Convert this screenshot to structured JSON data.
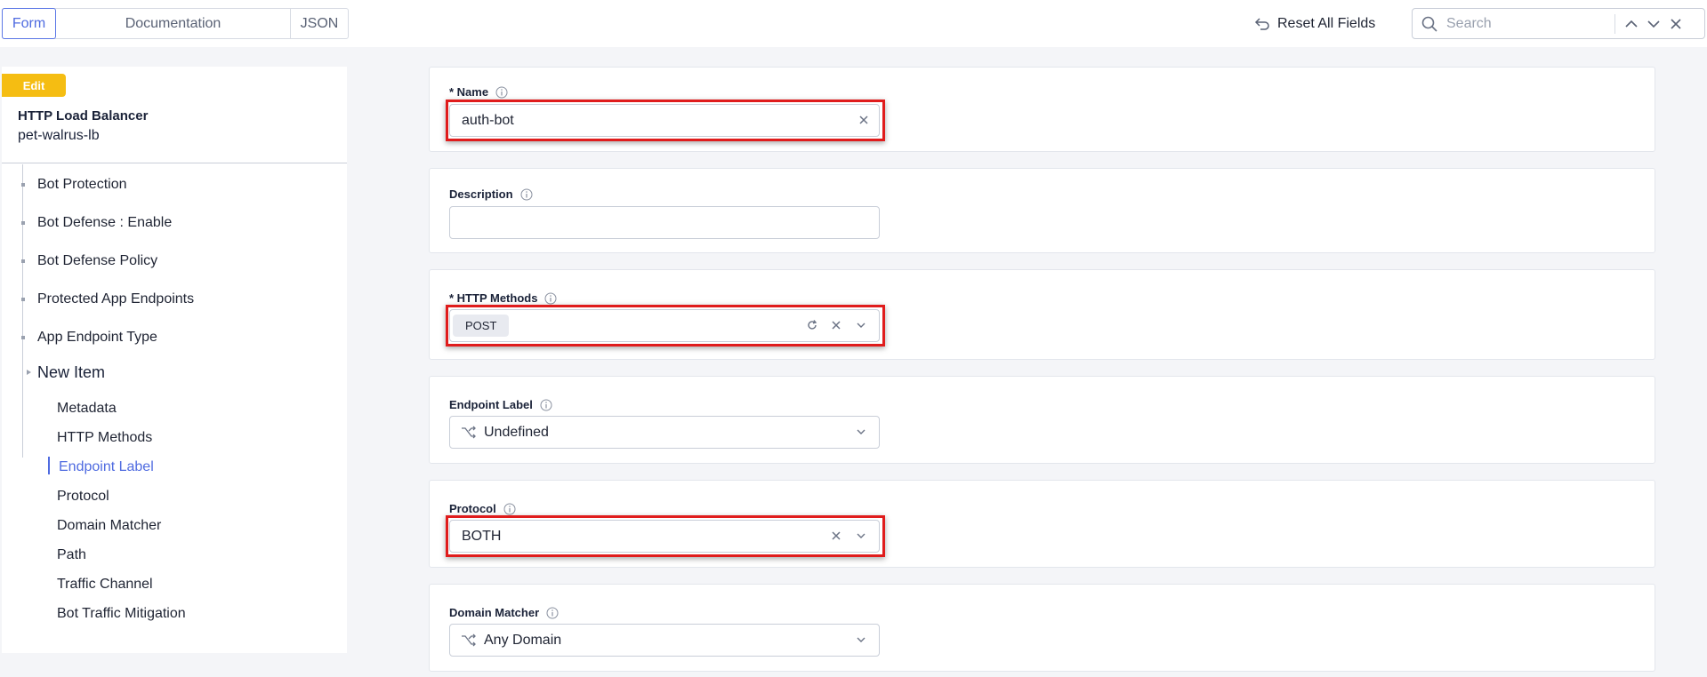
{
  "tabs": {
    "form": "Form",
    "documentation": "Documentation",
    "json": "JSON"
  },
  "toolbar": {
    "reset_label": "Reset All Fields",
    "search_placeholder": "Search"
  },
  "sidebar": {
    "badge": "Edit",
    "object_type": "HTTP Load Balancer",
    "object_name": "pet-walrus-lb",
    "items": [
      {
        "label": "Bot Protection"
      },
      {
        "label": "Bot Defense : Enable"
      },
      {
        "label": "Bot Defense Policy"
      },
      {
        "label": "Protected App Endpoints"
      },
      {
        "label": "App Endpoint Type"
      }
    ],
    "new_item": "New Item",
    "sub_items": [
      {
        "label": "Metadata"
      },
      {
        "label": "HTTP Methods"
      },
      {
        "label": "Endpoint Label",
        "active": true
      },
      {
        "label": "Protocol"
      },
      {
        "label": "Domain Matcher"
      },
      {
        "label": "Path"
      },
      {
        "label": "Traffic Channel"
      },
      {
        "label": "Bot Traffic Mitigation"
      }
    ]
  },
  "form": {
    "name": {
      "label": "* Name",
      "value": "auth-bot"
    },
    "description": {
      "label": "Description",
      "value": ""
    },
    "http_methods": {
      "label": "* HTTP Methods",
      "selected": [
        "POST"
      ]
    },
    "endpoint_label": {
      "label": "Endpoint Label",
      "value": "Undefined"
    },
    "protocol": {
      "label": "Protocol",
      "value": "BOTH"
    },
    "domain_matcher": {
      "label": "Domain Matcher",
      "value": "Any Domain"
    }
  },
  "colors": {
    "accent": "#4f6be0",
    "badge": "#f5bd12",
    "highlight": "#e01c1c"
  }
}
